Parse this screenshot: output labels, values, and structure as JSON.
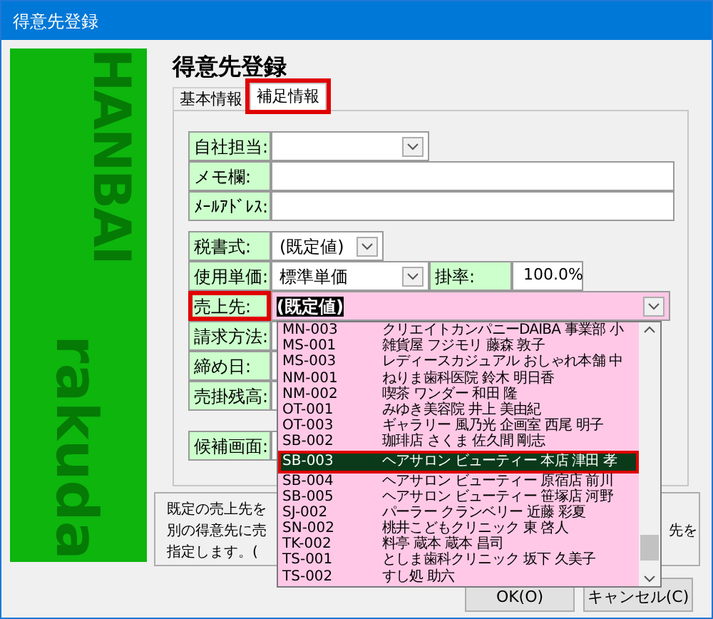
{
  "window": {
    "title": "得意先登録"
  },
  "sidebar": {
    "texts": [
      "HANBAI",
      "rakuda"
    ]
  },
  "heading": "得意先登録",
  "tabs": [
    {
      "label": "基本情報",
      "selected": false,
      "highlighted": false
    },
    {
      "label": "補足情報",
      "selected": true,
      "highlighted": true
    }
  ],
  "form": {
    "groups": [
      {
        "rows": [
          {
            "kind": "combo",
            "label": "自社担当:",
            "highlighted": false
          },
          {
            "kind": "text",
            "label": "メモ欄:",
            "highlighted": false
          },
          {
            "kind": "text",
            "label": "ﾒｰﾙｱﾄﾞﾚｽ:",
            "highlighted": false
          }
        ]
      },
      {
        "rows": [
          {
            "kind": "combo",
            "label": "税書式:",
            "value": "(既定値)",
            "highlighted": false
          },
          {
            "kind": "combo_rate",
            "label": "使用単価:",
            "value": "標準単価",
            "rate_label": "掛率:",
            "rate_value": "100.0%",
            "highlighted": false
          },
          {
            "kind": "open_combo",
            "label": "売上先:",
            "value": "(既定値)",
            "highlighted": true
          },
          {
            "kind": "hidden",
            "label": "請求方法:",
            "highlighted": false
          },
          {
            "kind": "hidden",
            "label": "締め日:",
            "highlighted": false
          },
          {
            "kind": "hidden",
            "label": "売掛残高:",
            "highlighted": false
          }
        ]
      },
      {
        "rows": [
          {
            "kind": "hidden",
            "label": "候補画面:",
            "highlighted": false
          }
        ]
      }
    ]
  },
  "dropdown": {
    "items": [
      {
        "code": "MN-003",
        "name": "クリエイトカンパニーDAIBA 事業部 小",
        "selected": false
      },
      {
        "code": "MS-001",
        "name": "雑貨屋 フジモリ 藤森 敦子",
        "selected": false
      },
      {
        "code": "MS-003",
        "name": "レディースカジュアル おしゃれ本舗 中",
        "selected": false
      },
      {
        "code": "NM-001",
        "name": "ねりま歯科医院 鈴木 明日香",
        "selected": false
      },
      {
        "code": "NM-002",
        "name": "喫茶 ワンダー 和田 隆",
        "selected": false
      },
      {
        "code": "OT-001",
        "name": "みゆき美容院 井上 美由紀",
        "selected": false
      },
      {
        "code": "OT-003",
        "name": "ギャラリー 風乃光 企画室 西尾 明子",
        "selected": false
      },
      {
        "code": "SB-002",
        "name": "珈琲店 さくま 佐久間 剛志",
        "selected": false
      },
      {
        "code": "SB-003",
        "name": "ヘアサロン ビューティー 本店 津田 孝",
        "selected": true
      },
      {
        "code": "SB-004",
        "name": "ヘアサロン ビューティー 原宿店 前川",
        "selected": false
      },
      {
        "code": "SB-005",
        "name": "ヘアサロン ビューティー 笹塚店 河野",
        "selected": false
      },
      {
        "code": "SJ-002",
        "name": "パーラー クランベリー 近藤 彩夏",
        "selected": false
      },
      {
        "code": "SN-002",
        "name": "桃井こどもクリニック 東 啓人",
        "selected": false
      },
      {
        "code": "TK-002",
        "name": "料亭 蔵本 蔵本 昌司",
        "selected": false
      },
      {
        "code": "TS-001",
        "name": "としま歯科クリニック 坂下 久美子",
        "selected": false
      },
      {
        "code": "TS-002",
        "name": "すし処 助六",
        "selected": false
      }
    ]
  },
  "help": {
    "lines": [
      "既定の売上先を",
      "別の得意先に売",
      "指定します。("
    ],
    "right_fragment": "先を"
  },
  "buttons": [
    "OK(O)",
    "キャンセル(C)"
  ]
}
